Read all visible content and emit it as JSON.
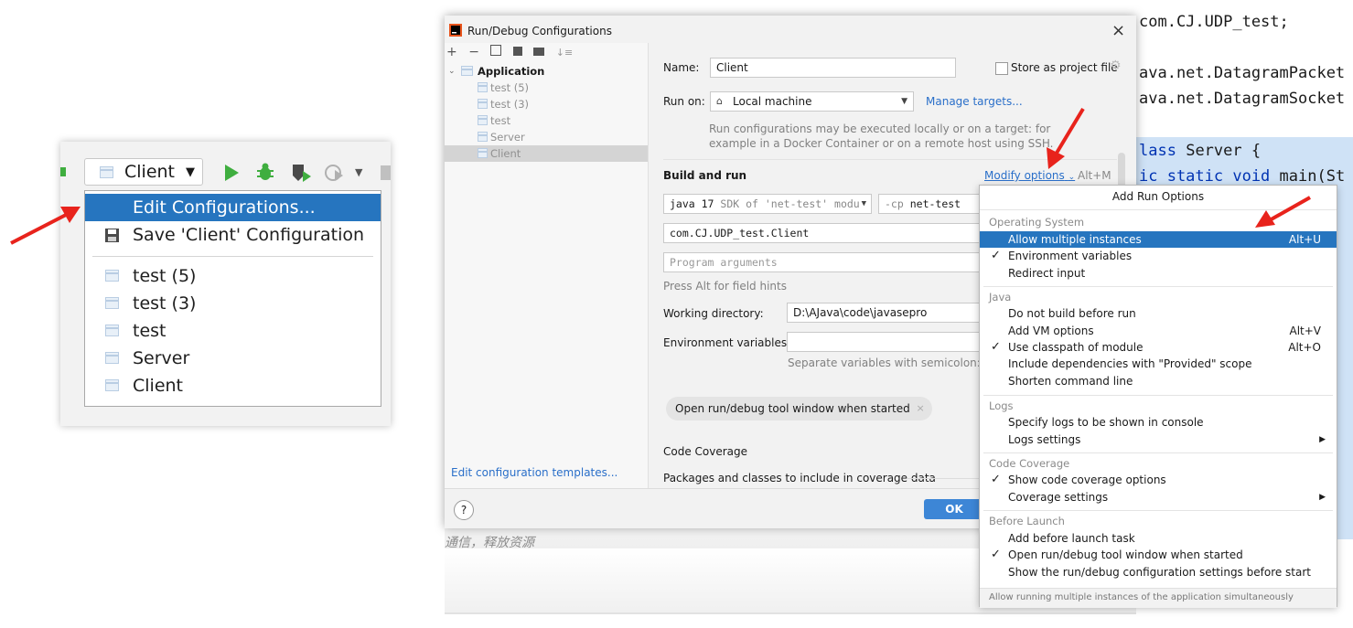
{
  "toolbar": {
    "config_name": "Client"
  },
  "run_config_menu": {
    "items": [
      "Edit Configurations...",
      "Save 'Client' Configuration"
    ],
    "configs": [
      "test (5)",
      "test (3)",
      "test",
      "Server",
      "Client"
    ]
  },
  "dialog": {
    "title": "Run/Debug Configurations",
    "tree": {
      "root": "Application",
      "children": [
        "test (5)",
        "test (3)",
        "test",
        "Server",
        "Client"
      ]
    },
    "edit_templates_link": "Edit configuration templates...",
    "name_label": "Name:",
    "name_value": "Client",
    "store_as_project_file": "Store as project file",
    "run_on_label": "Run on:",
    "run_on_value": "Local machine",
    "manage_targets": "Manage targets...",
    "run_on_hint_1": "Run configurations may be executed locally or on a target: for",
    "run_on_hint_2": "example in a Docker Container or on a remote host using SSH.",
    "build_and_run": "Build and run",
    "modify_options": "Modify options",
    "modify_options_shortcut": "Alt+M",
    "jdk_version": "java 17",
    "jdk_desc": "SDK of 'net-test' modul",
    "cp_flag": "-cp",
    "cp_module": "net-test",
    "main_class": "com.CJ.UDP_test.Client",
    "program_args_placeholder": "Program arguments",
    "field_hints": "Press Alt for field hints",
    "working_dir_label": "Working directory:",
    "working_dir_value": "D:\\AJava\\code\\javasepro",
    "env_vars_label": "Environment variables:",
    "env_vars_hint": "Separate variables with semicolon: VAR",
    "tag_open_tool_window": "Open run/debug tool window when started",
    "code_coverage": "Code Coverage",
    "packages_classes": "Packages and classes to include in coverage data",
    "ok": "OK",
    "help": "?"
  },
  "popup": {
    "title": "Add Run Options",
    "sections": [
      {
        "header": "Operating System",
        "items": [
          {
            "label": "Allow multiple instances",
            "shortcut": "Alt+U",
            "checked": false,
            "selected": true
          },
          {
            "label": "Environment variables",
            "checked": true
          },
          {
            "label": "Redirect input",
            "checked": false
          }
        ]
      },
      {
        "header": "Java",
        "items": [
          {
            "label": "Do not build before run",
            "checked": false
          },
          {
            "label": "Add VM options",
            "shortcut": "Alt+V",
            "checked": false
          },
          {
            "label": "Use classpath of module",
            "shortcut": "Alt+O",
            "checked": true
          },
          {
            "label": "Include dependencies with \"Provided\" scope",
            "checked": false
          },
          {
            "label": "Shorten command line",
            "checked": false
          }
        ]
      },
      {
        "header": "Logs",
        "items": [
          {
            "label": "Specify logs to be shown in console",
            "checked": false
          },
          {
            "label": "Logs settings",
            "checked": false,
            "submenu": true
          }
        ]
      },
      {
        "header": "Code Coverage",
        "items": [
          {
            "label": "Show code coverage options",
            "checked": true
          },
          {
            "label": "Coverage settings",
            "checked": false,
            "submenu": true
          }
        ]
      },
      {
        "header": "Before Launch",
        "items": [
          {
            "label": "Add before launch task",
            "checked": false
          },
          {
            "label": "Open run/debug tool window when started",
            "checked": true
          },
          {
            "label": "Show the run/debug configuration settings before start",
            "checked": false
          }
        ]
      }
    ],
    "footer": "Allow running multiple instances of the application simultaneously"
  },
  "editor": {
    "lines": [
      "com.CJ.UDP_test;",
      "ava.net.DatagramPacket",
      "ava.net.DatagramSocket"
    ],
    "class_kw": "lass",
    "class_name": "Server {",
    "main_kw": "ic static void",
    "main_rest": "main(St",
    "comment": "通信，释放资源"
  },
  "colors": {
    "selection": "#2675bf",
    "link": "#2a6fc9",
    "keyword": "#0033b3",
    "run_green": "#3fae3f",
    "arrow_red": "#e8231c"
  }
}
